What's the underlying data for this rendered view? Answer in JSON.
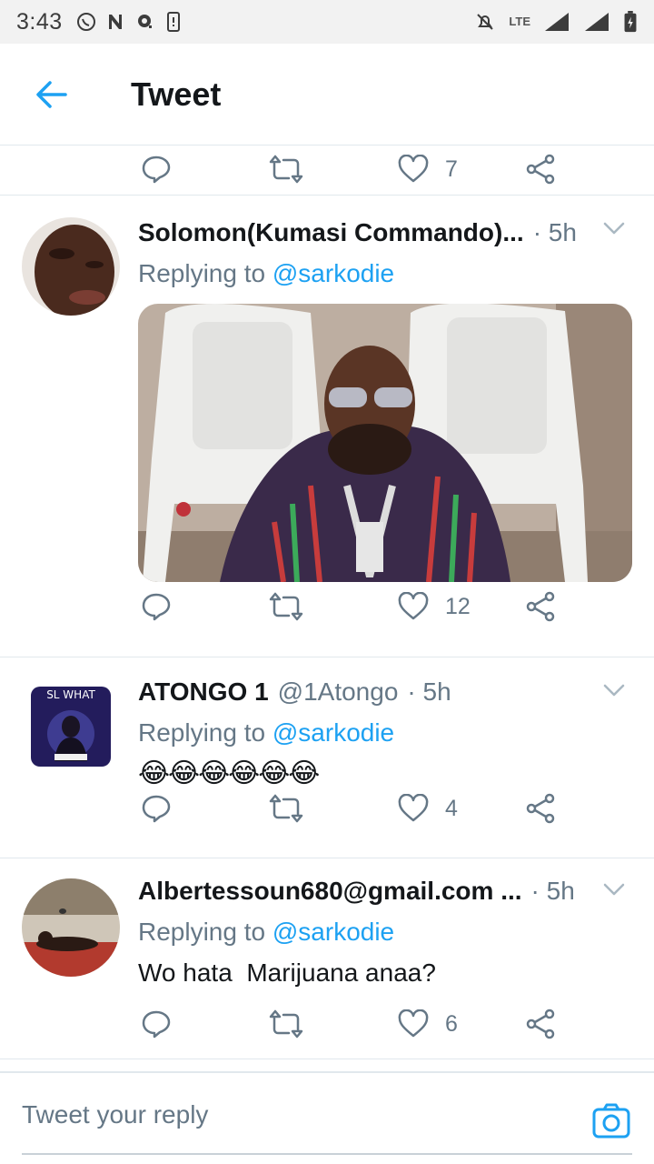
{
  "status_bar": {
    "time": "3:43",
    "network": "LTE"
  },
  "app_bar": {
    "title": "Tweet"
  },
  "top_actions": {
    "like_count": "7"
  },
  "tweets": [
    {
      "name": "Solomon(Kumasi Commando)...",
      "handle": "",
      "time": "· 5h",
      "replying_prefix": "Replying to",
      "replying_to": "@sarkodie",
      "text": "",
      "like_count": "12",
      "has_media": true
    },
    {
      "name": "ATONGO 1",
      "handle": "@1Atongo",
      "time": "· 5h",
      "replying_prefix": "Replying to",
      "replying_to": "@sarkodie",
      "text": "😂😂😂😂😂😂",
      "like_count": "4",
      "avatar_text": "SL WHAT"
    },
    {
      "name": "Albertessoun680@gmail.com ...",
      "handle": "",
      "time": "· 5h",
      "replying_prefix": "Replying to",
      "replying_to": "@sarkodie",
      "text": "Wo hata  Marijuana anaa?",
      "like_count": "6"
    }
  ],
  "reply_bar": {
    "placeholder": "Tweet your reply"
  },
  "colors": {
    "accent": "#1da1f2",
    "secondary_text": "#657786",
    "divider": "#e1e8ed"
  }
}
